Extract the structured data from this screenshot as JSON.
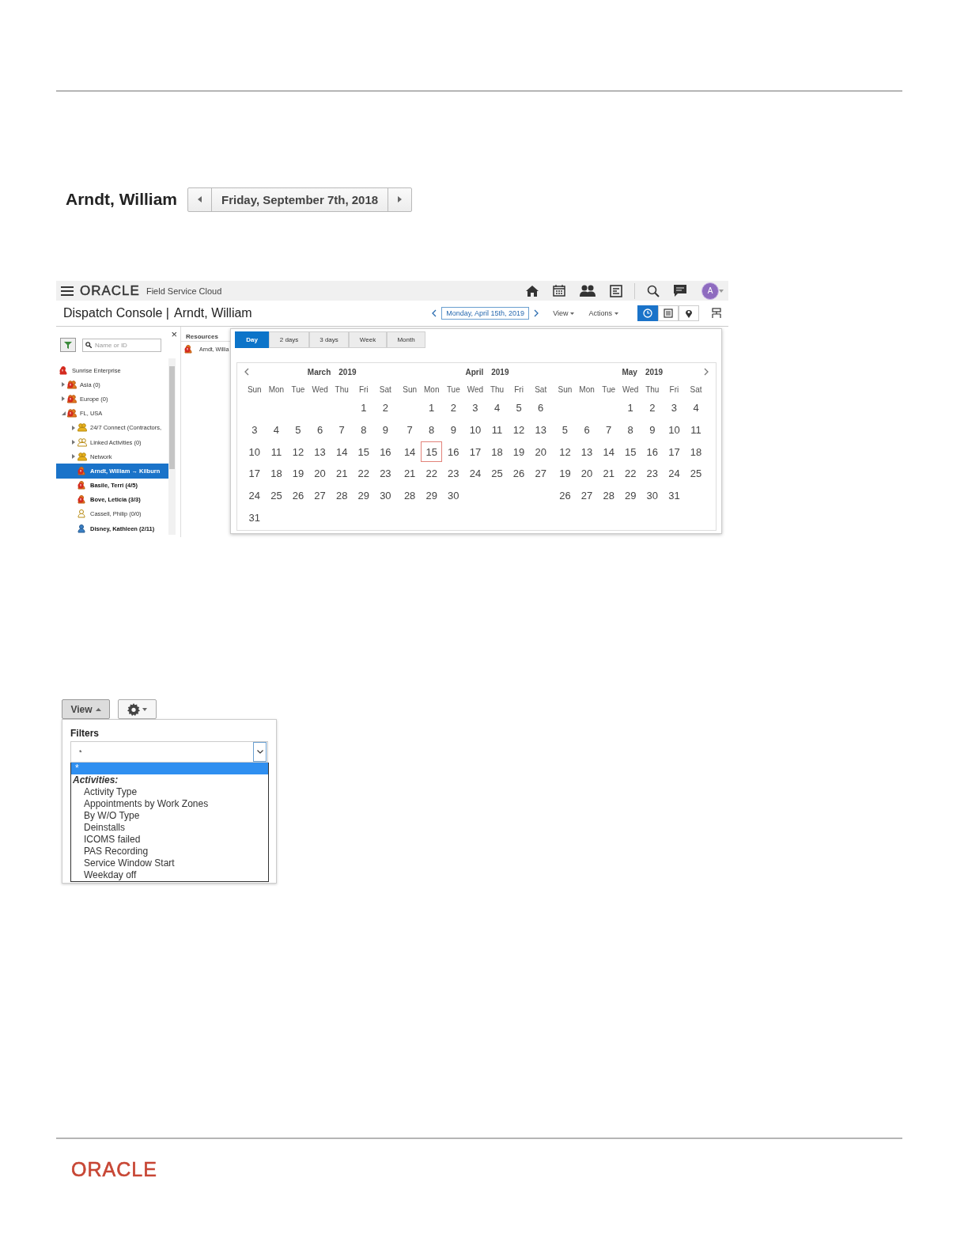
{
  "doc_header": {
    "name": "Arndt, William",
    "date": "Friday, September 7th, 2018"
  },
  "console": {
    "brand": "ORACLE",
    "product": "Field Service Cloud",
    "avatar": "A",
    "title": "Dispatch Console |",
    "resource": "Arndt, William",
    "date": "Monday, April 15th, 2019",
    "view_menu": "View",
    "actions_menu": "Actions",
    "view_modes": [
      {
        "kind": "clock",
        "selected": true
      },
      {
        "kind": "list",
        "selected": false
      },
      {
        "kind": "pin",
        "selected": false
      }
    ],
    "tree_panel": {
      "close": "×",
      "search": {
        "placeholder": "Name or ID"
      },
      "tree": [
        {
          "label": "Sunrise Enterprise",
          "kind": "enterprise",
          "bold": false,
          "selected": false,
          "children": [
            {
              "label": "Asia (0)",
              "kind": "group-alert",
              "bold": false,
              "selected": false,
              "expanded": false
            },
            {
              "label": "Europe (0)",
              "kind": "group-alert",
              "bold": false,
              "selected": false,
              "expanded": false
            },
            {
              "label": "FL, USA",
              "kind": "group-alert",
              "bold": false,
              "selected": false,
              "expanded": true,
              "children": [
                {
                  "label": "24/7 Connect (Contractors,",
                  "kind": "group",
                  "bold": false,
                  "selected": false,
                  "expanded": false
                },
                {
                  "label": "Linked Activities (0)",
                  "kind": "group-outline",
                  "bold": false,
                  "selected": false,
                  "expanded": false
                },
                {
                  "label": "Network",
                  "kind": "group",
                  "bold": false,
                  "selected": false,
                  "expanded": false
                },
                {
                  "label": "Arndt, William → Kilburn",
                  "kind": "person-alert",
                  "bold": true,
                  "selected": true
                },
                {
                  "label": "Basile, Terri (4/5)",
                  "kind": "person-alert",
                  "bold": true,
                  "selected": false
                },
                {
                  "label": "Bove, Leticia (3/3)",
                  "kind": "person-alert",
                  "bold": true,
                  "selected": false
                },
                {
                  "label": "Cassell, Philip (0/0)",
                  "kind": "person-outline",
                  "bold": false,
                  "selected": false
                },
                {
                  "label": "Disney, Kathleen (2/11)",
                  "kind": "person",
                  "bold": true,
                  "selected": false
                }
              ]
            }
          ]
        }
      ]
    },
    "resources": {
      "header": "Resources",
      "row": "Arndt, Willia"
    },
    "range_tabs": [
      {
        "label": "Day",
        "selected": true
      },
      {
        "label": "2 days",
        "selected": false
      },
      {
        "label": "3 days",
        "selected": false
      },
      {
        "label": "Week",
        "selected": false
      },
      {
        "label": "Month",
        "selected": false
      }
    ],
    "calendar": {
      "months": [
        {
          "title": "March",
          "year": "2019",
          "weekdays": [
            "Sun",
            "Mon",
            "Tue",
            "Wed",
            "Thu",
            "Fri",
            "Sat"
          ],
          "weeks": [
            [
              {
                "kind": "blank"
              },
              {
                "kind": "blank"
              },
              {
                "kind": "blank"
              },
              {
                "kind": "blank"
              },
              {
                "kind": "blank"
              },
              {
                "kind": "day",
                "d": "1",
                "selected": false
              },
              {
                "kind": "day",
                "d": "2",
                "selected": false
              }
            ],
            [
              {
                "kind": "day",
                "d": "3",
                "selected": false
              },
              {
                "kind": "day",
                "d": "4",
                "selected": false
              },
              {
                "kind": "day",
                "d": "5",
                "selected": false
              },
              {
                "kind": "day",
                "d": "6",
                "selected": false
              },
              {
                "kind": "day",
                "d": "7",
                "selected": false
              },
              {
                "kind": "day",
                "d": "8",
                "selected": false
              },
              {
                "kind": "day",
                "d": "9",
                "selected": false
              }
            ],
            [
              {
                "kind": "day",
                "d": "10",
                "selected": false
              },
              {
                "kind": "day",
                "d": "11",
                "selected": false
              },
              {
                "kind": "day",
                "d": "12",
                "selected": false
              },
              {
                "kind": "day",
                "d": "13",
                "selected": false
              },
              {
                "kind": "day",
                "d": "14",
                "selected": false
              },
              {
                "kind": "day",
                "d": "15",
                "selected": false
              },
              {
                "kind": "day",
                "d": "16",
                "selected": false
              }
            ],
            [
              {
                "kind": "day",
                "d": "17",
                "selected": false
              },
              {
                "kind": "day",
                "d": "18",
                "selected": false
              },
              {
                "kind": "day",
                "d": "19",
                "selected": false
              },
              {
                "kind": "day",
                "d": "20",
                "selected": false
              },
              {
                "kind": "day",
                "d": "21",
                "selected": false
              },
              {
                "kind": "day",
                "d": "22",
                "selected": false
              },
              {
                "kind": "day",
                "d": "23",
                "selected": false
              }
            ],
            [
              {
                "kind": "day",
                "d": "24",
                "selected": false
              },
              {
                "kind": "day",
                "d": "25",
                "selected": false
              },
              {
                "kind": "day",
                "d": "26",
                "selected": false
              },
              {
                "kind": "day",
                "d": "27",
                "selected": false
              },
              {
                "kind": "day",
                "d": "28",
                "selected": false
              },
              {
                "kind": "day",
                "d": "29",
                "selected": false
              },
              {
                "kind": "day",
                "d": "30",
                "selected": false
              }
            ],
            [
              {
                "kind": "day",
                "d": "31",
                "selected": false
              }
            ]
          ]
        },
        {
          "title": "April",
          "year": "2019",
          "weekdays": [
            "Sun",
            "Mon",
            "Tue",
            "Wed",
            "Thu",
            "Fri",
            "Sat"
          ],
          "weeks": [
            [
              {
                "kind": "blank"
              },
              {
                "kind": "day",
                "d": "1",
                "selected": false
              },
              {
                "kind": "day",
                "d": "2",
                "selected": false
              },
              {
                "kind": "day",
                "d": "3",
                "selected": false
              },
              {
                "kind": "day",
                "d": "4",
                "selected": false
              },
              {
                "kind": "day",
                "d": "5",
                "selected": false
              },
              {
                "kind": "day",
                "d": "6",
                "selected": false
              }
            ],
            [
              {
                "kind": "day",
                "d": "7",
                "selected": false
              },
              {
                "kind": "day",
                "d": "8",
                "selected": false
              },
              {
                "kind": "day",
                "d": "9",
                "selected": false
              },
              {
                "kind": "day",
                "d": "10",
                "selected": false
              },
              {
                "kind": "day",
                "d": "11",
                "selected": false
              },
              {
                "kind": "day",
                "d": "12",
                "selected": false
              },
              {
                "kind": "day",
                "d": "13",
                "selected": false
              }
            ],
            [
              {
                "kind": "day",
                "d": "14",
                "selected": false
              },
              {
                "kind": "day",
                "d": "15",
                "selected": true
              },
              {
                "kind": "day",
                "d": "16",
                "selected": false
              },
              {
                "kind": "day",
                "d": "17",
                "selected": false
              },
              {
                "kind": "day",
                "d": "18",
                "selected": false
              },
              {
                "kind": "day",
                "d": "19",
                "selected": false
              },
              {
                "kind": "day",
                "d": "20",
                "selected": false
              }
            ],
            [
              {
                "kind": "day",
                "d": "21",
                "selected": false
              },
              {
                "kind": "day",
                "d": "22",
                "selected": false
              },
              {
                "kind": "day",
                "d": "23",
                "selected": false
              },
              {
                "kind": "day",
                "d": "24",
                "selected": false
              },
              {
                "kind": "day",
                "d": "25",
                "selected": false
              },
              {
                "kind": "day",
                "d": "26",
                "selected": false
              },
              {
                "kind": "day",
                "d": "27",
                "selected": false
              }
            ],
            [
              {
                "kind": "day",
                "d": "28",
                "selected": false
              },
              {
                "kind": "day",
                "d": "29",
                "selected": false
              },
              {
                "kind": "day",
                "d": "30",
                "selected": false
              }
            ]
          ]
        },
        {
          "title": "May",
          "year": "2019",
          "weekdays": [
            "Sun",
            "Mon",
            "Tue",
            "Wed",
            "Thu",
            "Fri",
            "Sat"
          ],
          "weeks": [
            [
              {
                "kind": "blank"
              },
              {
                "kind": "blank"
              },
              {
                "kind": "blank"
              },
              {
                "kind": "day",
                "d": "1",
                "selected": false
              },
              {
                "kind": "day",
                "d": "2",
                "selected": false
              },
              {
                "kind": "day",
                "d": "3",
                "selected": false
              },
              {
                "kind": "day",
                "d": "4",
                "selected": false
              }
            ],
            [
              {
                "kind": "day",
                "d": "5",
                "selected": false
              },
              {
                "kind": "day",
                "d": "6",
                "selected": false
              },
              {
                "kind": "day",
                "d": "7",
                "selected": false
              },
              {
                "kind": "day",
                "d": "8",
                "selected": false
              },
              {
                "kind": "day",
                "d": "9",
                "selected": false
              },
              {
                "kind": "day",
                "d": "10",
                "selected": false
              },
              {
                "kind": "day",
                "d": "11",
                "selected": false
              }
            ],
            [
              {
                "kind": "day",
                "d": "12",
                "selected": false
              },
              {
                "kind": "day",
                "d": "13",
                "selected": false
              },
              {
                "kind": "day",
                "d": "14",
                "selected": false
              },
              {
                "kind": "day",
                "d": "15",
                "selected": false
              },
              {
                "kind": "day",
                "d": "16",
                "selected": false
              },
              {
                "kind": "day",
                "d": "17",
                "selected": false
              },
              {
                "kind": "day",
                "d": "18",
                "selected": false
              }
            ],
            [
              {
                "kind": "day",
                "d": "19",
                "selected": false
              },
              {
                "kind": "day",
                "d": "20",
                "selected": false
              },
              {
                "kind": "day",
                "d": "21",
                "selected": false
              },
              {
                "kind": "day",
                "d": "22",
                "selected": false
              },
              {
                "kind": "day",
                "d": "23",
                "selected": false
              },
              {
                "kind": "day",
                "d": "24",
                "selected": false
              },
              {
                "kind": "day",
                "d": "25",
                "selected": false
              }
            ],
            [
              {
                "kind": "day",
                "d": "26",
                "selected": false
              },
              {
                "kind": "day",
                "d": "27",
                "selected": false
              },
              {
                "kind": "day",
                "d": "28",
                "selected": false
              },
              {
                "kind": "day",
                "d": "29",
                "selected": false
              },
              {
                "kind": "day",
                "d": "30",
                "selected": false
              },
              {
                "kind": "day",
                "d": "31",
                "selected": false
              }
            ]
          ]
        }
      ]
    }
  },
  "filters_screen": {
    "view_button": "View",
    "filters_label": "Filters",
    "select_value": "*",
    "options": [
      {
        "label": "*",
        "kind": "option",
        "selected": true
      },
      {
        "label": "Activities:",
        "kind": "group",
        "selected": false
      },
      {
        "label": "Activity Type",
        "kind": "option",
        "selected": false
      },
      {
        "label": "Appointments by Work Zones",
        "kind": "option",
        "selected": false
      },
      {
        "label": "By W/O Type",
        "kind": "option",
        "selected": false
      },
      {
        "label": "Deinstalls",
        "kind": "option",
        "selected": false
      },
      {
        "label": "ICOMS failed",
        "kind": "option",
        "selected": false
      },
      {
        "label": "PAS Recording",
        "kind": "option",
        "selected": false
      },
      {
        "label": "Service Window Start",
        "kind": "option",
        "selected": false
      },
      {
        "label": "Weekday off",
        "kind": "option",
        "selected": false
      }
    ]
  },
  "footer": {
    "logo": "ORACLE"
  }
}
